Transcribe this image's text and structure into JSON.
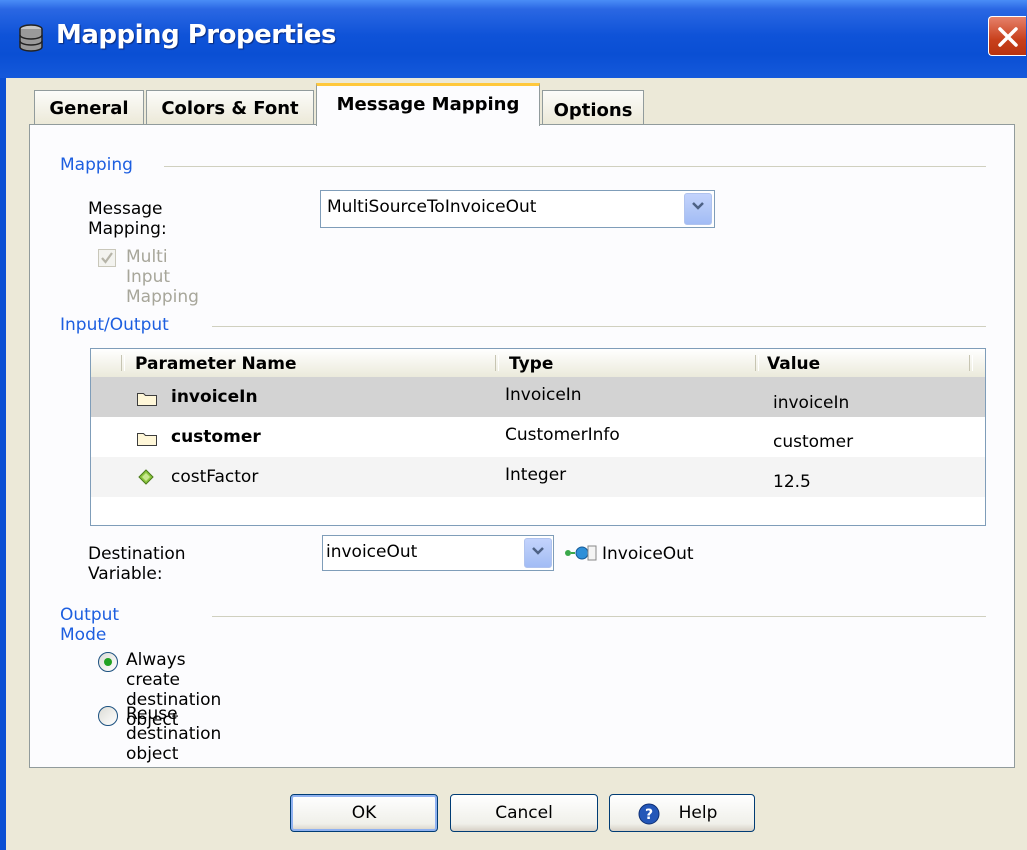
{
  "window": {
    "title": "Mapping Properties"
  },
  "tabs": [
    {
      "label": "General"
    },
    {
      "label": "Colors & Font"
    },
    {
      "label": "Message Mapping"
    },
    {
      "label": "Options"
    }
  ],
  "mapping": {
    "group_label": "Mapping",
    "message_mapping_label": "Message Mapping:",
    "message_mapping_value": "MultiSourceToInvoiceOut",
    "multi_input_label": "Multi Input Mapping",
    "multi_input_checked": true
  },
  "io": {
    "group_label": "Input/Output",
    "columns": [
      "Parameter Name",
      "Type",
      "Value"
    ],
    "rows": [
      {
        "name": "invoiceIn",
        "type": "InvoiceIn",
        "value": "invoiceIn",
        "icon": "folder-icon",
        "selected": true
      },
      {
        "name": "customer",
        "type": "CustomerInfo",
        "value": "customer",
        "icon": "folder-icon",
        "selected": false
      },
      {
        "name": "costFactor",
        "type": "Integer",
        "value": "12.5",
        "icon": "diamond-icon",
        "selected": false
      }
    ],
    "destination_label": "Destination Variable:",
    "destination_value": "invoiceOut",
    "destination_type": "InvoiceOut"
  },
  "output_mode": {
    "group_label": "Output Mode",
    "options": [
      {
        "label": "Always create destination object",
        "selected": true
      },
      {
        "label": "Reuse destination object",
        "selected": false
      }
    ]
  },
  "buttons": {
    "ok": "OK",
    "cancel": "Cancel",
    "help": "Help"
  },
  "colors": {
    "title_bar": "#0a4fd4",
    "group_label": "#1c5ee0",
    "selected_row": "#d3d3d3",
    "active_tab_accent": "#ffc83c"
  }
}
